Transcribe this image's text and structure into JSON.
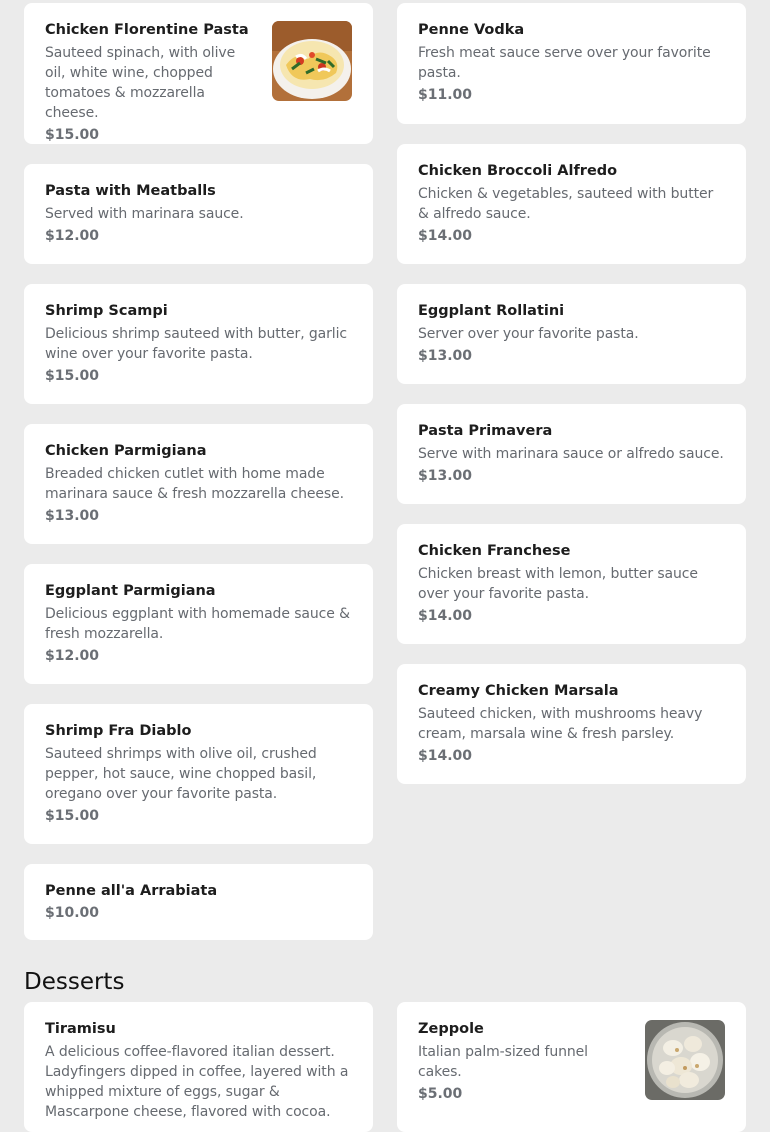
{
  "section": {
    "desserts_title": "Desserts"
  },
  "left_items": [
    {
      "name": "Chicken Florentine Pasta",
      "desc": "Sauteed spinach, with olive oil, white wine, chopped tomatoes & mozzarella cheese.",
      "price": "$15.00"
    },
    {
      "name": "Pasta with Meatballs",
      "desc": "Served with marinara sauce.",
      "price": "$12.00"
    },
    {
      "name": "Shrimp Scampi",
      "desc": "Delicious shrimp sauteed with butter, garlic wine over your favorite pasta.",
      "price": "$15.00"
    },
    {
      "name": "Chicken Parmigiana",
      "desc": "Breaded chicken cutlet with home made marinara sauce & fresh mozzarella cheese.",
      "price": "$13.00"
    },
    {
      "name": "Eggplant Parmigiana",
      "desc": "Delicious eggplant with homemade sauce & fresh mozzarella.",
      "price": "$12.00"
    },
    {
      "name": "Shrimp Fra Diablo",
      "desc": "Sauteed shrimps with olive oil, crushed pepper, hot sauce, wine chopped basil, oregano over your favorite pasta.",
      "price": "$15.00"
    },
    {
      "name": "Penne all'a Arrabiata",
      "price": "$10.00"
    }
  ],
  "right_items": [
    {
      "name": "Penne Vodka",
      "desc": "Fresh meat sauce serve over your favorite pasta.",
      "price": "$11.00"
    },
    {
      "name": "Chicken Broccoli Alfredo",
      "desc": "Chicken & vegetables, sauteed with butter & alfredo sauce.",
      "price": "$14.00"
    },
    {
      "name": "Eggplant Rollatini",
      "desc": "Server over your favorite pasta.",
      "price": "$13.00"
    },
    {
      "name": "Pasta Primavera",
      "desc": "Serve with marinara sauce or alfredo sauce.",
      "price": "$13.00"
    },
    {
      "name": "Chicken Franchese",
      "desc": "Chicken breast with lemon, butter sauce over your favorite pasta.",
      "price": "$14.00"
    },
    {
      "name": "Creamy Chicken Marsala",
      "desc": "Sauteed chicken, with mushrooms heavy cream, marsala wine & fresh parsley.",
      "price": "$14.00"
    }
  ],
  "desserts": [
    {
      "name": "Tiramisu",
      "desc": "A delicious coffee-flavored italian dessert. Ladyfingers dipped in coffee, layered with a whipped mixture of eggs, sugar & Mascarpone cheese, flavored with cocoa."
    },
    {
      "name": "Zeppole",
      "desc": "Italian palm-sized funnel cakes.",
      "price": "$5.00"
    }
  ],
  "images": {
    "florentine": "chicken-florentine-pasta-photo",
    "zeppole": "zeppole-photo"
  }
}
